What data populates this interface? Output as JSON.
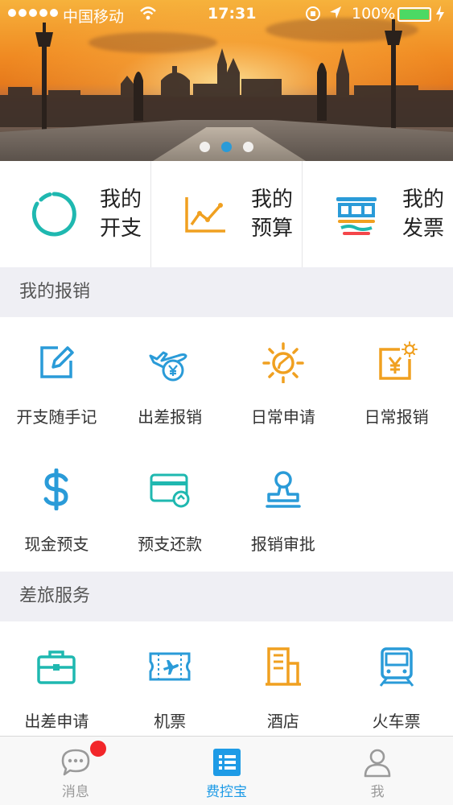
{
  "status_bar": {
    "carrier": "中国移动",
    "time": "17:31",
    "battery": "100%"
  },
  "banner": {
    "slide_count": 3,
    "active_slide": 2
  },
  "quick_tiles": [
    {
      "label": "我的\n开支",
      "icon": "ring-chart-icon",
      "color": "#1fb8b0"
    },
    {
      "label": "我的\n预算",
      "icon": "line-chart-icon",
      "color": "#f0a020"
    },
    {
      "label": "我的\n发票",
      "icon": "invoice-icon",
      "color": "#2a9bd8"
    }
  ],
  "reimburse_section": {
    "title": "我的报销",
    "items": [
      {
        "label": "开支随手记",
        "icon": "edit-note-icon"
      },
      {
        "label": "出差报销",
        "icon": "plane-yen-icon"
      },
      {
        "label": "日常申请",
        "icon": "sun-pen-icon"
      },
      {
        "label": "日常报销",
        "icon": "sun-yen-icon"
      },
      {
        "label": "现金预支",
        "icon": "dollar-icon"
      },
      {
        "label": "预支还款",
        "icon": "card-refund-icon"
      },
      {
        "label": "报销审批",
        "icon": "stamp-icon"
      }
    ]
  },
  "travel_section": {
    "title": "差旅服务",
    "items": [
      {
        "label": "出差申请",
        "icon": "briefcase-icon"
      },
      {
        "label": "机票",
        "icon": "plane-ticket-icon"
      },
      {
        "label": "酒店",
        "icon": "hotel-icon"
      },
      {
        "label": "火车票",
        "icon": "train-icon"
      }
    ]
  },
  "tab_bar": {
    "tabs": [
      {
        "label": "消息",
        "icon": "chat-bubble-icon",
        "active": false,
        "badge": true
      },
      {
        "label": "费控宝",
        "icon": "list-icon",
        "active": true,
        "badge": false
      },
      {
        "label": "我",
        "icon": "person-icon",
        "active": false,
        "badge": false
      }
    ]
  },
  "colors": {
    "accent_blue": "#2a9bd8",
    "accent_teal": "#1fb8b0",
    "accent_orange": "#f0a020",
    "badge_red": "#f2262a"
  }
}
